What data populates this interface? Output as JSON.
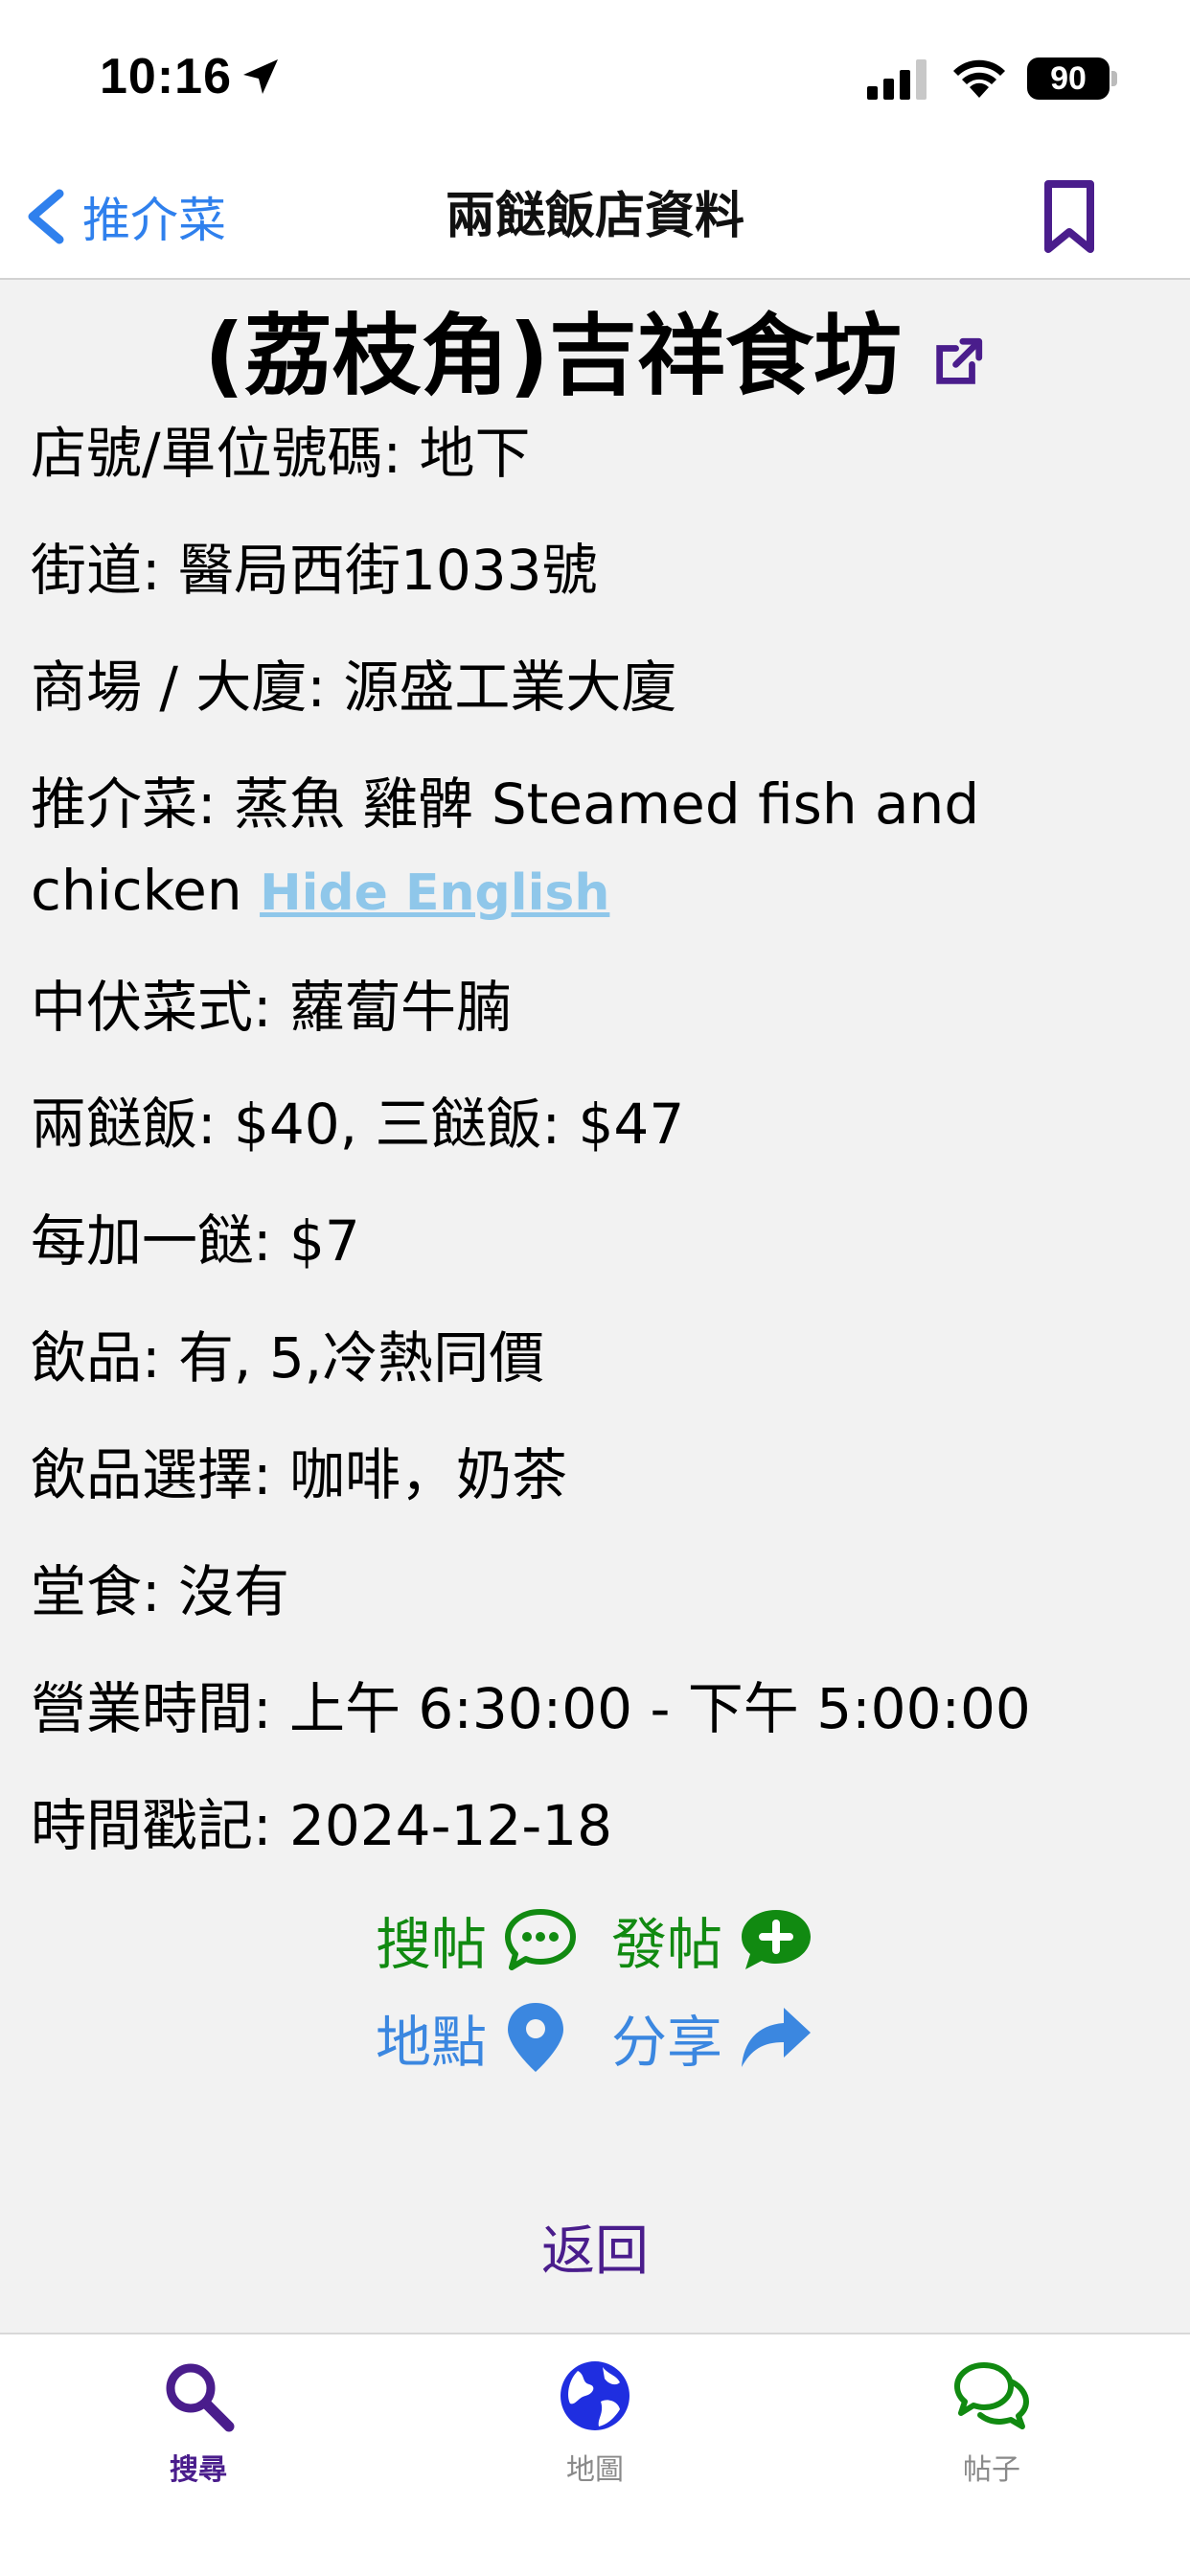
{
  "status": {
    "time": "10:16",
    "battery": "90"
  },
  "nav": {
    "back_label": "推介菜",
    "title": "兩餸飯店資料"
  },
  "restaurant": {
    "name": "(荔枝角)吉祥食坊",
    "fields": {
      "shop_no": "店號/單位號碼: 地下",
      "street": "街道: 醫局西街1033號",
      "building": "商場 / 大廈: 源盛工業大廈",
      "recommend_prefix": "推介菜: 蒸魚  雞髀 Steamed fish and",
      "recommend_suffix": "chicken",
      "hide_english": "Hide English",
      "dish": "中伏菜式: 蘿蔔牛腩",
      "price": "兩餸飯: $40, 三餸飯: $47",
      "extra": "每加一餸: $7",
      "drinks": "飲品: 有, 5,冷熱同價",
      "drink_choice": "飲品選擇: 咖啡，奶茶",
      "dine_in": "堂食: 沒有",
      "hours": "營業時間: 上午 6:30:00 - 下午 5:00:00",
      "timestamp": "時間戳記: 2024-12-18"
    }
  },
  "actions": {
    "search_posts": "搜帖",
    "new_post": "發帖",
    "location": "地點",
    "share": "分享"
  },
  "back_link": "返回",
  "tabs": [
    {
      "label": "搜尋",
      "color": "#4a1d8c"
    },
    {
      "label": "地圖",
      "color": "#8a8a8a"
    },
    {
      "label": "帖子",
      "color": "#8a8a8a"
    }
  ],
  "colors": {
    "accent_purple": "#4a1d8c",
    "link_blue": "#2f80ed",
    "green": "#118a11",
    "hide_english": "#8fc7ea"
  }
}
